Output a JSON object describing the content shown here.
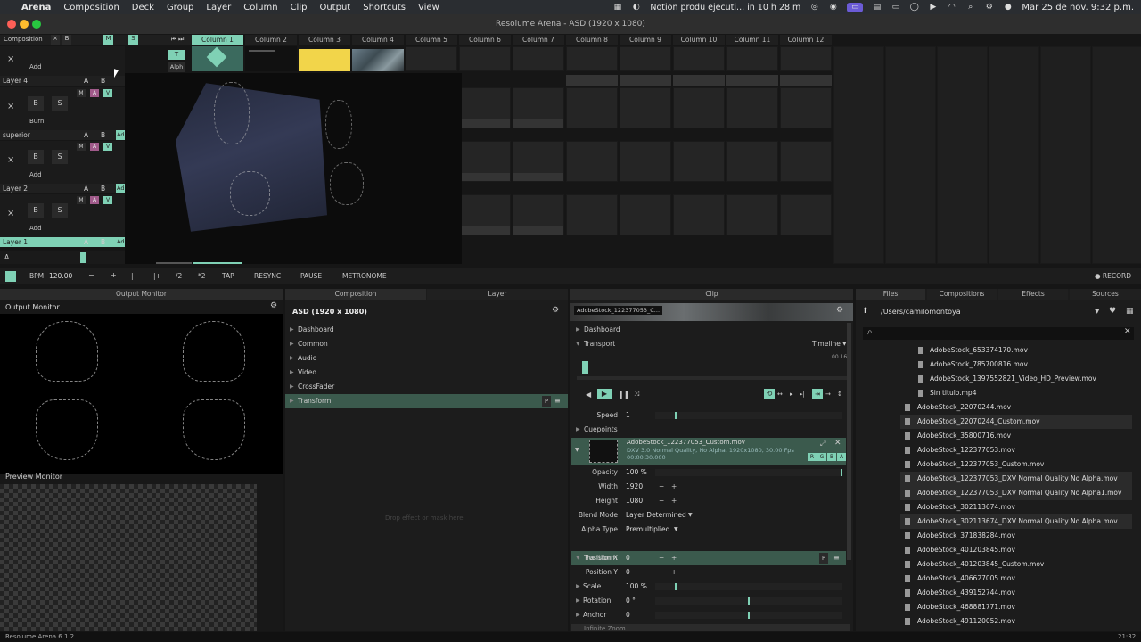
{
  "menubar": {
    "app": "Arena",
    "items": [
      "Composition",
      "Deck",
      "Group",
      "Layer",
      "Column",
      "Clip",
      "Output",
      "Shortcuts",
      "View"
    ],
    "notification": "Notion produ ejecuti... in 10 h 28 m",
    "datetime": "Mar 25 de nov.  9:32 p.m."
  },
  "window": {
    "title": "Resolume Arena - ASD (1920 x 1080)"
  },
  "comp_bar": {
    "composition": "Composition",
    "x": "×",
    "b": "B",
    "m": "M",
    "s": "S"
  },
  "columns": [
    "Column 1",
    "Column 2",
    "Column 3",
    "Column 4",
    "Column 5",
    "Column 6",
    "Column 7",
    "Column 8",
    "Column 9",
    "Column 10",
    "Column 11",
    "Column 12"
  ],
  "layers": [
    {
      "name": "Layer 4",
      "blend": "Add"
    },
    {
      "name": "superior",
      "blend": "Burn"
    },
    {
      "name": "Layer 2",
      "blend": "Add"
    },
    {
      "name": "Layer 1",
      "blend": "Add"
    }
  ],
  "layer_buttons": {
    "a": "A",
    "b": "B",
    "bb": "B",
    "s": "S",
    "x": "×",
    "m": "M",
    "v": "V",
    "ad": "Ad",
    "t": "T",
    "alph": "Alph"
  },
  "transport_bar": {
    "bpm_label": "BPM",
    "bpm_value": "120.00",
    "minus": "−",
    "plus": "+",
    "back": "|−",
    "fwd": "|+",
    "half": "/2",
    "double": "*2",
    "tap": "TAP",
    "resync": "RESYNC",
    "pause": "PAUSE",
    "metronome": "METRONOME",
    "record": "● RECORD",
    "a_label": "A"
  },
  "output_monitor": {
    "tab": "Output Monitor",
    "title": "Output Monitor",
    "preview_title": "Preview Monitor"
  },
  "composition_panel": {
    "tabs": [
      "Composition",
      "Layer"
    ],
    "title": "ASD (1920 x 1080)",
    "sections": [
      "Dashboard",
      "Common",
      "Audio",
      "Video",
      "CrossFader",
      "Transform"
    ],
    "drop_hint": "Drop effect or mask here",
    "p_btn": "P"
  },
  "clip_panel": {
    "tab": "Clip",
    "clip_name": "AdobeStock_122377053_C...",
    "dashboard": "Dashboard",
    "transport": "Transport",
    "timeline": "Timeline",
    "time": "00.16",
    "speed_label": "Speed",
    "speed_value": "1",
    "cuepoints": "Cuepoints",
    "file_name": "AdobeStock_122377053_Custom.mov",
    "file_info": "DXV 3.0 Normal Quality, No Alpha, 1920x1080, 30.00 Fps",
    "file_duration": "00:00:30.000",
    "rgba": [
      "R",
      "G",
      "B",
      "A"
    ],
    "props": [
      {
        "label": "Opacity",
        "value": "100 %"
      },
      {
        "label": "Width",
        "value": "1920"
      },
      {
        "label": "Height",
        "value": "1080"
      },
      {
        "label": "Blend Mode",
        "value": "Layer Determined"
      },
      {
        "label": "Alpha Type",
        "value": "Premultiplied"
      }
    ],
    "transform_title": "Transform",
    "transform_props": [
      {
        "label": "Position X",
        "value": "0"
      },
      {
        "label": "Position Y",
        "value": "0"
      },
      {
        "label": "Scale",
        "value": "100 %"
      },
      {
        "label": "Rotation",
        "value": "0 °"
      },
      {
        "label": "Anchor",
        "value": "0"
      }
    ],
    "cut_off": "Infinite Zoom",
    "minus": "−",
    "plus": "+"
  },
  "browser": {
    "tabs": [
      "Files",
      "Compositions",
      "Effects",
      "Sources"
    ],
    "path": "/Users/camilomontoya",
    "search_placeholder": "",
    "files_sub": [
      "AdobeStock_653374170.mov",
      "AdobeStock_785700816.mov",
      "AdobeStock_1397552821_Video_HD_Preview.mov",
      "Sin titulo.mp4"
    ],
    "files": [
      "AdobeStock_22070244.mov",
      "AdobeStock_22070244_Custom.mov",
      "AdobeStock_35800716.mov",
      "AdobeStock_122377053.mov",
      "AdobeStock_122377053_Custom.mov",
      "AdobeStock_122377053_DXV Normal Quality No Alpha.mov",
      "AdobeStock_122377053_DXV Normal Quality No Alpha1.mov",
      "AdobeStock_302113674.mov",
      "AdobeStock_302113674_DXV Normal Quality No Alpha.mov",
      "AdobeStock_371838284.mov",
      "AdobeStock_401203845.mov",
      "AdobeStock_401203845_Custom.mov",
      "AdobeStock_406627005.mov",
      "AdobeStock_439152744.mov",
      "AdobeStock_468881771.mov",
      "AdobeStock_491120052.mov"
    ]
  },
  "statusbar": {
    "version": "Resolume Arena 6.1.2",
    "time": "21:32"
  },
  "colors": {
    "accent": "#7fd1b5",
    "panel": "#1c1c1c",
    "bar_green": "#3b5a4d"
  }
}
